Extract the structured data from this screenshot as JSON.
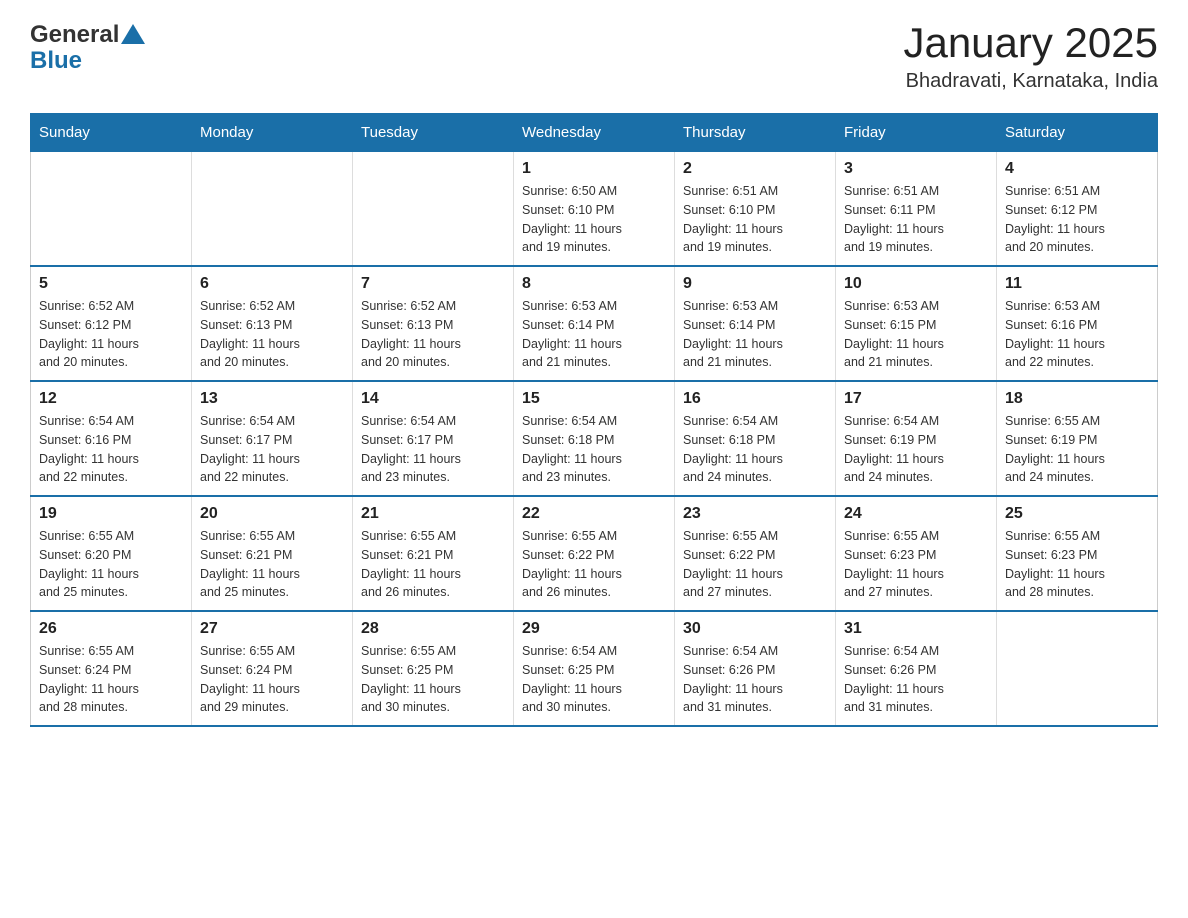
{
  "logo": {
    "general": "General",
    "blue": "Blue"
  },
  "title": "January 2025",
  "location": "Bhadravati, Karnataka, India",
  "weekdays": [
    "Sunday",
    "Monday",
    "Tuesday",
    "Wednesday",
    "Thursday",
    "Friday",
    "Saturday"
  ],
  "weeks": [
    [
      {
        "day": "",
        "info": ""
      },
      {
        "day": "",
        "info": ""
      },
      {
        "day": "",
        "info": ""
      },
      {
        "day": "1",
        "info": "Sunrise: 6:50 AM\nSunset: 6:10 PM\nDaylight: 11 hours\nand 19 minutes."
      },
      {
        "day": "2",
        "info": "Sunrise: 6:51 AM\nSunset: 6:10 PM\nDaylight: 11 hours\nand 19 minutes."
      },
      {
        "day": "3",
        "info": "Sunrise: 6:51 AM\nSunset: 6:11 PM\nDaylight: 11 hours\nand 19 minutes."
      },
      {
        "day": "4",
        "info": "Sunrise: 6:51 AM\nSunset: 6:12 PM\nDaylight: 11 hours\nand 20 minutes."
      }
    ],
    [
      {
        "day": "5",
        "info": "Sunrise: 6:52 AM\nSunset: 6:12 PM\nDaylight: 11 hours\nand 20 minutes."
      },
      {
        "day": "6",
        "info": "Sunrise: 6:52 AM\nSunset: 6:13 PM\nDaylight: 11 hours\nand 20 minutes."
      },
      {
        "day": "7",
        "info": "Sunrise: 6:52 AM\nSunset: 6:13 PM\nDaylight: 11 hours\nand 20 minutes."
      },
      {
        "day": "8",
        "info": "Sunrise: 6:53 AM\nSunset: 6:14 PM\nDaylight: 11 hours\nand 21 minutes."
      },
      {
        "day": "9",
        "info": "Sunrise: 6:53 AM\nSunset: 6:14 PM\nDaylight: 11 hours\nand 21 minutes."
      },
      {
        "day": "10",
        "info": "Sunrise: 6:53 AM\nSunset: 6:15 PM\nDaylight: 11 hours\nand 21 minutes."
      },
      {
        "day": "11",
        "info": "Sunrise: 6:53 AM\nSunset: 6:16 PM\nDaylight: 11 hours\nand 22 minutes."
      }
    ],
    [
      {
        "day": "12",
        "info": "Sunrise: 6:54 AM\nSunset: 6:16 PM\nDaylight: 11 hours\nand 22 minutes."
      },
      {
        "day": "13",
        "info": "Sunrise: 6:54 AM\nSunset: 6:17 PM\nDaylight: 11 hours\nand 22 minutes."
      },
      {
        "day": "14",
        "info": "Sunrise: 6:54 AM\nSunset: 6:17 PM\nDaylight: 11 hours\nand 23 minutes."
      },
      {
        "day": "15",
        "info": "Sunrise: 6:54 AM\nSunset: 6:18 PM\nDaylight: 11 hours\nand 23 minutes."
      },
      {
        "day": "16",
        "info": "Sunrise: 6:54 AM\nSunset: 6:18 PM\nDaylight: 11 hours\nand 24 minutes."
      },
      {
        "day": "17",
        "info": "Sunrise: 6:54 AM\nSunset: 6:19 PM\nDaylight: 11 hours\nand 24 minutes."
      },
      {
        "day": "18",
        "info": "Sunrise: 6:55 AM\nSunset: 6:19 PM\nDaylight: 11 hours\nand 24 minutes."
      }
    ],
    [
      {
        "day": "19",
        "info": "Sunrise: 6:55 AM\nSunset: 6:20 PM\nDaylight: 11 hours\nand 25 minutes."
      },
      {
        "day": "20",
        "info": "Sunrise: 6:55 AM\nSunset: 6:21 PM\nDaylight: 11 hours\nand 25 minutes."
      },
      {
        "day": "21",
        "info": "Sunrise: 6:55 AM\nSunset: 6:21 PM\nDaylight: 11 hours\nand 26 minutes."
      },
      {
        "day": "22",
        "info": "Sunrise: 6:55 AM\nSunset: 6:22 PM\nDaylight: 11 hours\nand 26 minutes."
      },
      {
        "day": "23",
        "info": "Sunrise: 6:55 AM\nSunset: 6:22 PM\nDaylight: 11 hours\nand 27 minutes."
      },
      {
        "day": "24",
        "info": "Sunrise: 6:55 AM\nSunset: 6:23 PM\nDaylight: 11 hours\nand 27 minutes."
      },
      {
        "day": "25",
        "info": "Sunrise: 6:55 AM\nSunset: 6:23 PM\nDaylight: 11 hours\nand 28 minutes."
      }
    ],
    [
      {
        "day": "26",
        "info": "Sunrise: 6:55 AM\nSunset: 6:24 PM\nDaylight: 11 hours\nand 28 minutes."
      },
      {
        "day": "27",
        "info": "Sunrise: 6:55 AM\nSunset: 6:24 PM\nDaylight: 11 hours\nand 29 minutes."
      },
      {
        "day": "28",
        "info": "Sunrise: 6:55 AM\nSunset: 6:25 PM\nDaylight: 11 hours\nand 30 minutes."
      },
      {
        "day": "29",
        "info": "Sunrise: 6:54 AM\nSunset: 6:25 PM\nDaylight: 11 hours\nand 30 minutes."
      },
      {
        "day": "30",
        "info": "Sunrise: 6:54 AM\nSunset: 6:26 PM\nDaylight: 11 hours\nand 31 minutes."
      },
      {
        "day": "31",
        "info": "Sunrise: 6:54 AM\nSunset: 6:26 PM\nDaylight: 11 hours\nand 31 minutes."
      },
      {
        "day": "",
        "info": ""
      }
    ]
  ]
}
